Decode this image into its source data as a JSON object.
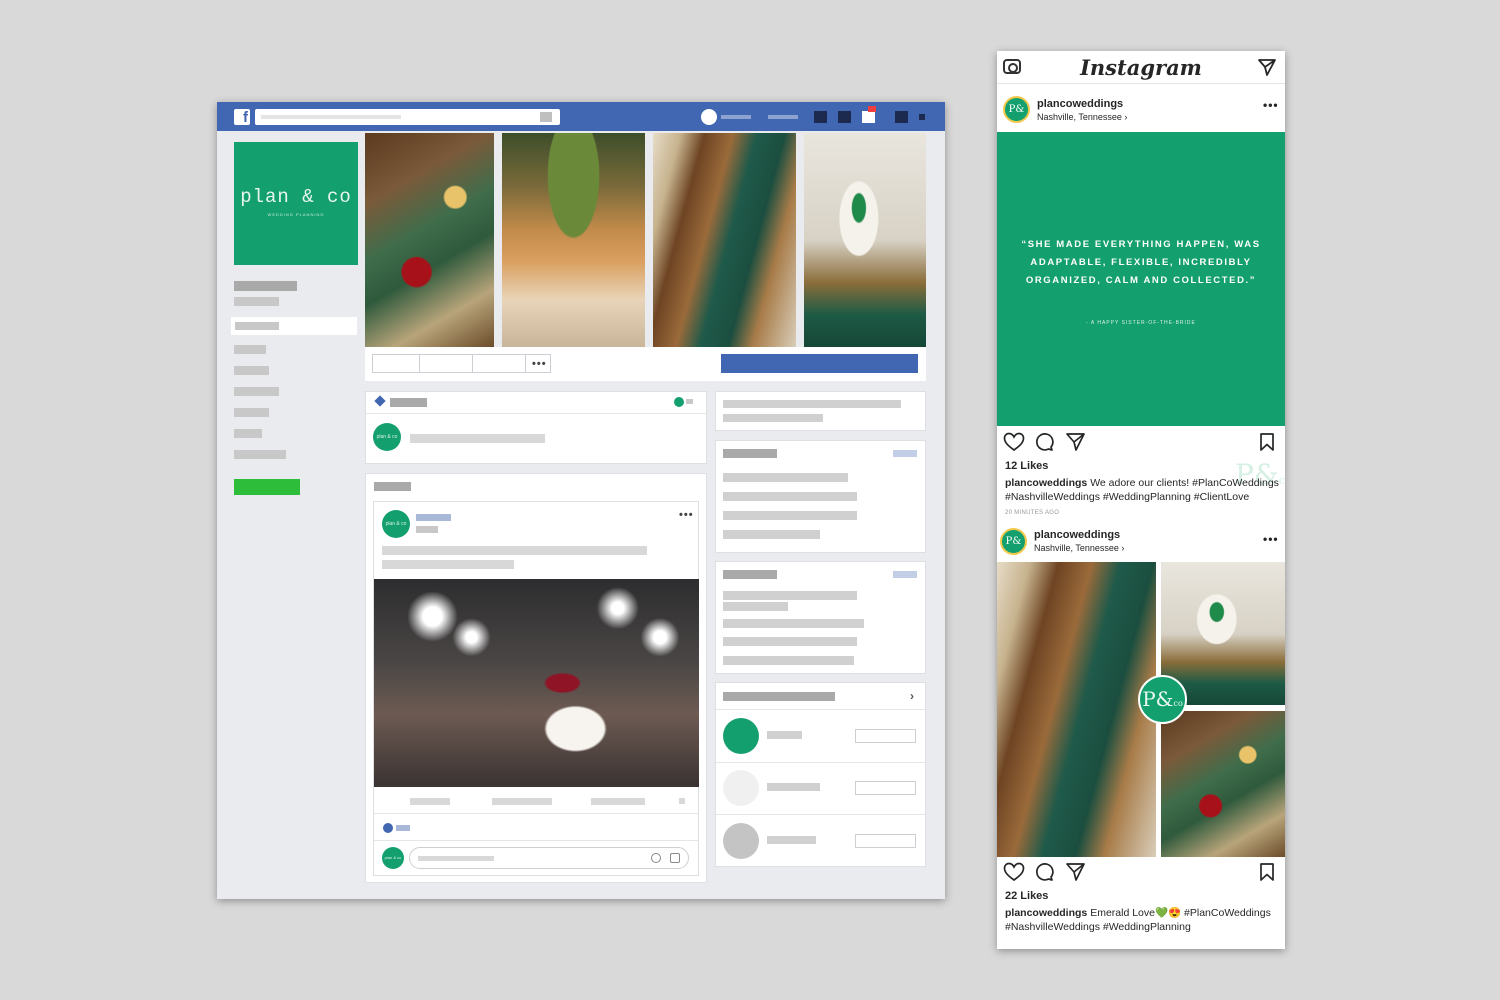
{
  "facebook": {
    "logo_letter": "f",
    "profile": {
      "brand": "plan & co",
      "tagline": "WEDDING PLANNING"
    },
    "cover_photos": [
      "centerpiece",
      "reception-hall",
      "table-setting",
      "geode-cake"
    ],
    "post": {
      "options_icon": "more-dots-icon",
      "photo": "sparkler-exit"
    },
    "colors": {
      "bar": "#4267b2",
      "brand_green": "#14a06e",
      "cta_green": "#2ebd3b"
    }
  },
  "instagram": {
    "app_name": "Instagram",
    "posts": [
      {
        "username": "plancoweddings",
        "location": "Nashville, Tennessee ›",
        "quote": "“SHE MADE EVERYTHING HAPPEN, WAS ADAPTABLE, FLEXIBLE, INCREDIBLY ORGANIZED, CALM AND COLLECTED.”",
        "attribution": "- A HAPPY SISTER-OF-THE-BRIDE",
        "monogram": "P&",
        "monogram_suffix": "co",
        "likes": "12 Likes",
        "caption": "We adore our clients! #PlanCoWeddings #NashvilleWeddings #WeddingPlanning #ClientLove",
        "time": "20 MINUTES AGO"
      },
      {
        "username": "plancoweddings",
        "location": "Nashville, Tennessee ›",
        "monogram": "P&",
        "monogram_suffix": "co",
        "likes": "22 Likes",
        "caption": "Emerald Love💚😍 #PlanCoWeddings #NashvilleWeddings #WeddingPlanning"
      }
    ],
    "avatar_mark": "P&",
    "colors": {
      "brand_green": "#14a06e",
      "text": "#262626"
    }
  }
}
